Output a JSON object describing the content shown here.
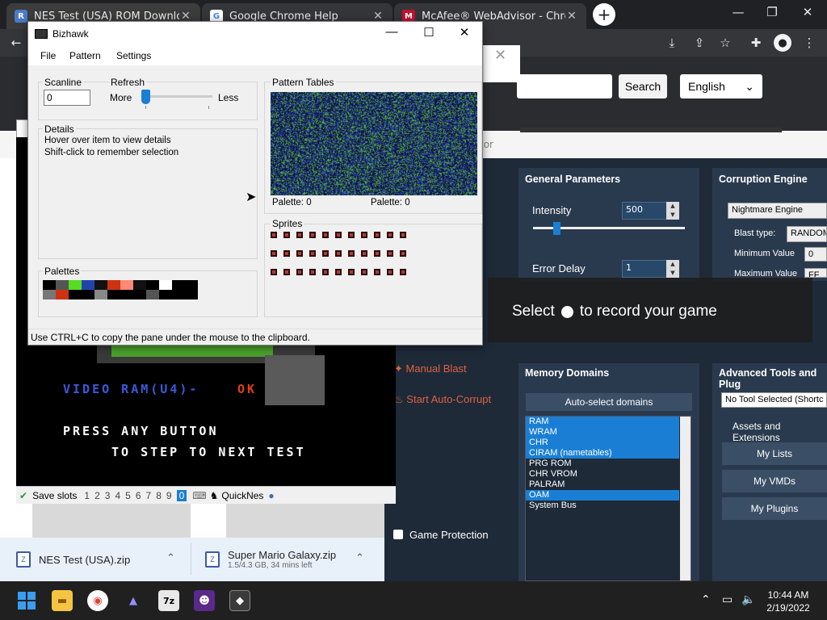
{
  "browser": {
    "tabs": [
      {
        "title": "NES Test (USA) ROM Download -",
        "favicon": "R"
      },
      {
        "title": "Google Chrome Help",
        "favicon": "G"
      },
      {
        "title": "McAfee® WebAdvisor - Chrome",
        "favicon": "M"
      }
    ],
    "new_tab_glyph": "+",
    "window_controls": [
      "—",
      "❐",
      "✕"
    ],
    "toolbar_icons": [
      "download-icon",
      "share-icon",
      "star-icon",
      "extensions-icon",
      "profile-icon",
      "menu-icon"
    ]
  },
  "webpage": {
    "search_button": "Search",
    "language": "English",
    "partial_title": "tor"
  },
  "rtc": {
    "general_parameters": {
      "title": "General Parameters",
      "intensity_label": "Intensity",
      "intensity_value": "500",
      "intensity_level": 0.05,
      "error_delay_label": "Error Delay",
      "error_delay_value": "1"
    },
    "corruption_engine": {
      "title": "Corruption Engine",
      "engine": "Nightmare Engine",
      "blast_type_label": "Blast type:",
      "blast_type_value": "RANDOM",
      "min_label": "Minimum Value",
      "min_value": "0",
      "max_label": "Maximum Value",
      "max_value": "FF"
    },
    "actions": {
      "manual_blast": "Manual Blast",
      "auto_corrupt": "Start Auto-Corrupt"
    },
    "memory_domains": {
      "title": "Memory Domains",
      "auto_select": "Auto-select domains",
      "items": [
        {
          "name": "RAM",
          "selected": true
        },
        {
          "name": "WRAM",
          "selected": true
        },
        {
          "name": "CHR",
          "selected": true
        },
        {
          "name": "CIRAM (nametables)",
          "selected": true
        },
        {
          "name": "PRG ROM",
          "selected": false
        },
        {
          "name": "CHR VROM",
          "selected": false
        },
        {
          "name": "PALRAM",
          "selected": false
        },
        {
          "name": "OAM",
          "selected": true
        },
        {
          "name": "System Bus",
          "selected": false
        }
      ]
    },
    "advanced_tools": {
      "title": "Advanced Tools and Plug",
      "tool_select": "No Tool Selected (Shortc",
      "assets": "Assets and Extensions",
      "my_lists": "My Lists",
      "my_vmds": "My VMDs",
      "my_plugins": "My Plugins"
    },
    "game_protection": "Game Protection"
  },
  "gamebar": {
    "text_before": "Select",
    "text_after": "to record your game"
  },
  "emulator": {
    "screen_lines": [
      {
        "text": "VIDEO RAM(U4)-",
        "color": "#3a5adb"
      },
      {
        "text": "OK",
        "color": "#e0401a"
      },
      {
        "text": "PRESS ANY BUTTON",
        "color": "#ffffff"
      },
      {
        "text": "TO STEP TO NEXT TEST",
        "color": "#ffffff"
      }
    ],
    "status": {
      "save_slots_label": "Save slots",
      "slots": [
        "1",
        "2",
        "3",
        "4",
        "5",
        "6",
        "7",
        "8",
        "9",
        "0"
      ],
      "current_slot": "0",
      "core": "QuickNes"
    }
  },
  "bizhawk": {
    "title": "Bizhawk",
    "menus": [
      "File",
      "Pattern",
      "Settings"
    ],
    "scanline_label": "Scanline",
    "scanline_value": "0",
    "refresh_label": "Refresh",
    "refresh_more": "More",
    "refresh_less": "Less",
    "refresh_level": 0.0,
    "details_label": "Details",
    "details_line1": "Hover over item to view details",
    "details_line2": "Shift-click to remember selection",
    "palettes_label": "Palettes",
    "palette_colors_top": [
      "#000000",
      "#555555",
      "#55dd22",
      "#2244aa",
      "#111111",
      "#cc3311",
      "#ff8877",
      "#111111",
      "#000000",
      "#ffffff",
      "#000000",
      "#000000"
    ],
    "palette_colors_bottom": [
      "#777777",
      "#cc3311",
      "#000000",
      "#000000",
      "#888888",
      "#000000",
      "#000000",
      "#000000",
      "#555555",
      "#000000",
      "#000000",
      "#000000"
    ],
    "pattern_tables_label": "Pattern Tables",
    "palette_left": "Palette: 0",
    "palette_right": "Palette: 0",
    "sprites_label": "Sprites",
    "status_text": "Use CTRL+C to copy the pane under the mouse to the clipboard."
  },
  "downloads": [
    {
      "name": "NES Test (USA).zip",
      "sub": ""
    },
    {
      "name": "Super Mario Galaxy.zip",
      "sub": "1.5/4.3 GB, 34 mins left"
    }
  ],
  "taskbar": {
    "time": "10:44 AM",
    "date": "2/19/2022"
  }
}
